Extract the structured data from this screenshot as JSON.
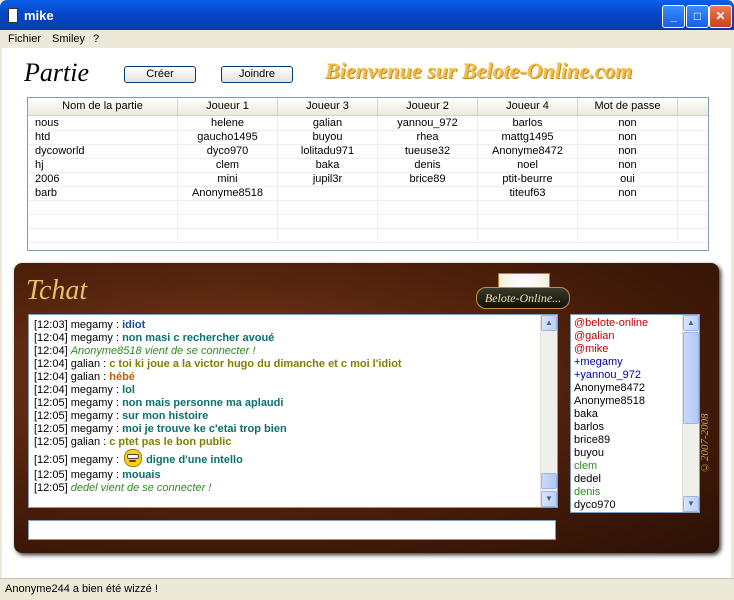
{
  "window": {
    "title": "mike",
    "minimize_glyph": "_",
    "maximize_glyph": "□",
    "close_glyph": "✕"
  },
  "menu": {
    "fichier": "Fichier",
    "smiley": "Smiley",
    "help": "?"
  },
  "header": {
    "partie_title": "Partie",
    "create_label": "Créer",
    "join_label": "Joindre",
    "welcome": "Bienvenue sur Belote-Online.com"
  },
  "games_table": {
    "columns": [
      "Nom de la partie",
      "Joueur 1",
      "Joueur 3",
      "Joueur 2",
      "Joueur 4",
      "Mot de passe"
    ],
    "rows": [
      [
        "nous",
        "helene",
        "galian",
        "yannou_972",
        "barlos",
        "non"
      ],
      [
        "htd",
        "gaucho1495",
        "buyou",
        "rhea",
        "mattg1495",
        "non"
      ],
      [
        "dycoworld",
        "dyco970",
        "lolitadu971",
        "tueuse32",
        "Anonyme8472",
        "non"
      ],
      [
        "hj",
        "clem",
        "baka",
        "denis",
        "noel",
        "non"
      ],
      [
        "2006",
        "mini",
        "jupil3r",
        "brice89",
        "ptit-beurre",
        "oui"
      ],
      [
        "barb",
        "Anonyme8518",
        "",
        "",
        "titeuf63",
        "non"
      ]
    ]
  },
  "chat": {
    "title": "Tchat",
    "logo_text": "Belote-Online...",
    "copyright": "©2007-2008",
    "messages": [
      {
        "time": "[12:03]",
        "user": "megamy :",
        "text": "idiot",
        "style": "s-blue"
      },
      {
        "time": "[12:04]",
        "user": "megamy :",
        "text": "non masi c rechercher avoué",
        "style": "s-teal"
      },
      {
        "time": "[12:04]",
        "user": "",
        "text": "Anonyme8518 vient de se connecter !",
        "style": "s-sys"
      },
      {
        "time": "[12:04]",
        "user": "galian :",
        "text": "c toi ki joue a la victor hugo du dimanche et c moi l'idiot",
        "style": "s-olive"
      },
      {
        "time": "[12:04]",
        "user": "galian :",
        "text": "hébé",
        "style": "s-orange"
      },
      {
        "time": "[12:04]",
        "user": "megamy :",
        "text": "lol",
        "style": "s-teal"
      },
      {
        "time": "[12:05]",
        "user": "megamy :",
        "text": "non mais personne ma aplaudi",
        "style": "s-teal"
      },
      {
        "time": "[12:05]",
        "user": "megamy :",
        "text": "sur mon histoire",
        "style": "s-teal"
      },
      {
        "time": "[12:05]",
        "user": "megamy :",
        "text": "moi je trouve ke c'etai trop bien",
        "style": "s-teal"
      },
      {
        "time": "[12:05]",
        "user": "galian :",
        "text": "c ptet pas le bon public",
        "style": "s-olive"
      },
      {
        "time": "[12:05]",
        "user": "megamy :",
        "text": "digne d'une intello",
        "style": "s-teal",
        "emoji": "smiley-glasses-icon"
      },
      {
        "time": "[12:05]",
        "user": "megamy :",
        "text": "mouais",
        "style": "s-teal"
      },
      {
        "time": "[12:05]",
        "user": "",
        "text": "dedel vient de se connecter !",
        "style": "s-sys"
      }
    ],
    "input_value": ""
  },
  "users": [
    {
      "name": "@belote-online",
      "color": "#c00000"
    },
    {
      "name": "@galian",
      "color": "#c00000"
    },
    {
      "name": "@mike",
      "color": "#c00000"
    },
    {
      "name": "+megamy",
      "color": "#0000a0"
    },
    {
      "name": "+yannou_972",
      "color": "#0000a0"
    },
    {
      "name": "Anonyme8472",
      "color": "#000000"
    },
    {
      "name": "Anonyme8518",
      "color": "#000000"
    },
    {
      "name": "baka",
      "color": "#000000"
    },
    {
      "name": "barlos",
      "color": "#000000"
    },
    {
      "name": "brice89",
      "color": "#000000"
    },
    {
      "name": "buyou",
      "color": "#000000"
    },
    {
      "name": "clem",
      "color": "#2e8b20"
    },
    {
      "name": "dedel",
      "color": "#000000"
    },
    {
      "name": "denis",
      "color": "#2e8b20"
    },
    {
      "name": "dyco970",
      "color": "#000000"
    }
  ],
  "status": {
    "text": "Anonyme244 a bien été wizzé !"
  }
}
